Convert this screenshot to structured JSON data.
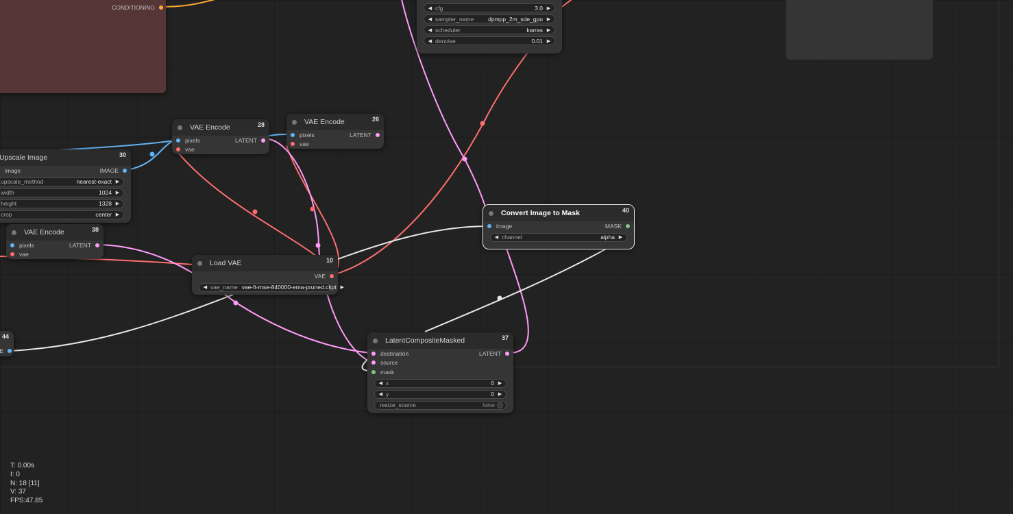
{
  "canvas": {
    "background": "#222222",
    "group_border": "#333445"
  },
  "wire_colors": {
    "image": "#64b5f6",
    "vae": "#ff6e6e",
    "latent": "#ff9cf9",
    "mask": "#e6e6e6",
    "conditioning": "#ffa931"
  },
  "nodes": {
    "conditioning_node": {
      "output": "CONDITIONING"
    },
    "sampler": {
      "widgets": [
        {
          "label": "cfg",
          "value": "3.0"
        },
        {
          "label": "sampler_name",
          "value": "dpmpp_2m_sde_gpu"
        },
        {
          "label": "scheduler",
          "value": "karras"
        },
        {
          "label": "denoise",
          "value": "0.01"
        }
      ]
    },
    "vae_encode_28": {
      "title": "VAE Encode",
      "id": "28",
      "inputs": [
        "pixels",
        "vae"
      ],
      "output": "LATENT"
    },
    "vae_encode_26": {
      "title": "VAE Encode",
      "id": "26",
      "inputs": [
        "pixels",
        "vae"
      ],
      "output": "LATENT"
    },
    "upscale_image": {
      "title": "Upscale Image",
      "id": "30",
      "input": "image",
      "output": "IMAGE",
      "widgets": [
        {
          "label": "upscale_method",
          "value": "nearest-exact"
        },
        {
          "label": "width",
          "value": "1024"
        },
        {
          "label": "height",
          "value": "1328"
        },
        {
          "label": "crop",
          "value": "center"
        }
      ]
    },
    "vae_encode_38": {
      "title": "VAE Encode",
      "id": "38",
      "inputs": [
        "pixels",
        "vae"
      ],
      "output": "LATENT"
    },
    "load_vae": {
      "title": "Load VAE",
      "id": "10",
      "output": "VAE",
      "widget": {
        "label": "vae_name",
        "value": "vae-ft-mse-840000-ema-pruned.ckpt"
      }
    },
    "convert_mask": {
      "title": "Convert Image to Mask",
      "id": "40",
      "input": "image",
      "output": "MASK",
      "widget": {
        "label": "channel",
        "value": "alpha"
      }
    },
    "latent_composite": {
      "title": "LatentCompositeMasked",
      "id": "37",
      "inputs": [
        "destination",
        "source",
        "mask"
      ],
      "output": "LATENT",
      "widgets": [
        {
          "label": "x",
          "value": "0"
        },
        {
          "label": "y",
          "value": "0"
        }
      ],
      "toggle": {
        "label": "resize_source",
        "value": "false"
      }
    },
    "node_44": {
      "id": "44",
      "output_fragment": "SE"
    }
  },
  "stats": {
    "t": "T: 0.00s",
    "i": "I: 0",
    "n": "N: 18 [11]",
    "v": "V: 37",
    "fps": "FPS:47.85"
  }
}
